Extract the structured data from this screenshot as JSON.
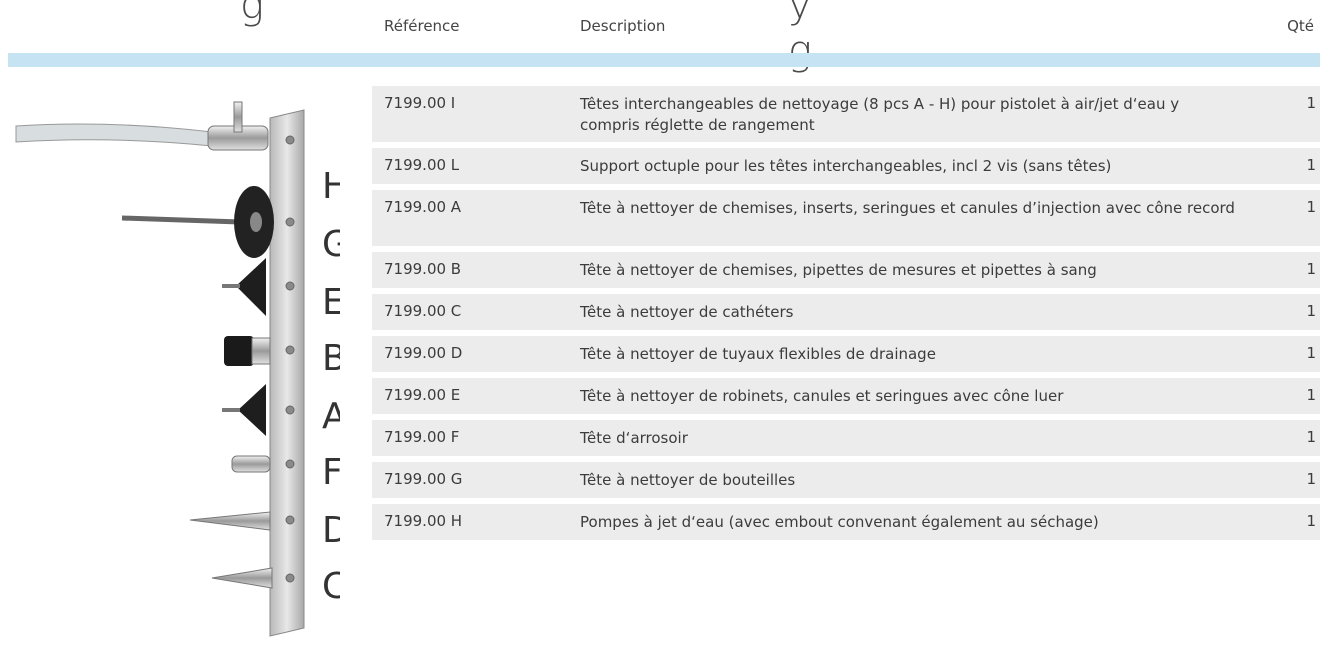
{
  "title_fragments": {
    "left": "g",
    "right": "y g"
  },
  "columns": {
    "reference": "Référence",
    "description": "Description",
    "quantity": "Qté"
  },
  "letters": [
    "H",
    "G",
    "E",
    "B",
    "A",
    "F",
    "D",
    "C"
  ],
  "rows": [
    {
      "ref": "7199.00 I",
      "desc": "Têtes interchangeables de nettoyage (8 pcs A - H) pour pistolet à air/jet d‘eau y compris réglette de rangement",
      "qty": "1"
    },
    {
      "ref": "7199.00 L",
      "desc": "Support octuple pour les têtes interchangeables, incl 2 vis (sans têtes)",
      "qty": "1"
    },
    {
      "ref": "7199.00 A",
      "desc": "Tête à nettoyer de chemises, inserts, seringues et canules d’injection avec cône record",
      "qty": "1"
    },
    {
      "ref": "7199.00 B",
      "desc": "Tête à nettoyer de chemises, pipettes de mesures et pipettes à sang",
      "qty": "1"
    },
    {
      "ref": "7199.00 C",
      "desc": "Tête à nettoyer de cathéters",
      "qty": "1"
    },
    {
      "ref": "7199.00 D",
      "desc": "Tête à nettoyer de tuyaux flexibles de drainage",
      "qty": "1"
    },
    {
      "ref": "7199.00 E",
      "desc": "Tête à nettoyer de robinets, canules et seringues avec cône luer",
      "qty": "1"
    },
    {
      "ref": "7199.00 F",
      "desc": "Tête d‘arrosoir",
      "qty": "1"
    },
    {
      "ref": "7199.00 G",
      "desc": "Tête à nettoyer de bouteilles",
      "qty": "1"
    },
    {
      "ref": "7199.00 H",
      "desc": "Pompes à jet d‘eau (avec embout convenant également au séchage)",
      "qty": "1"
    }
  ],
  "colors": {
    "band": "#c6e3f4",
    "row_bg": "#ececec",
    "text": "#3c3c3c"
  }
}
